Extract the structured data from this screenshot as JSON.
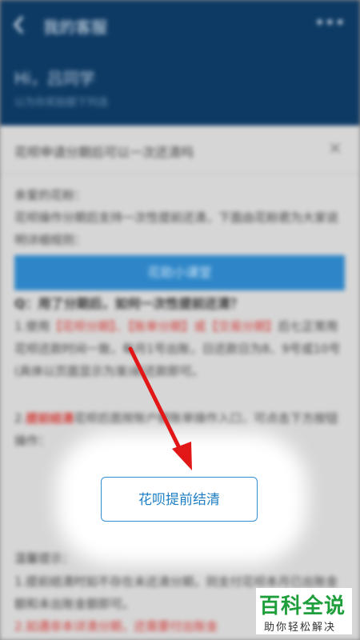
{
  "nav": {
    "back_icon": "chevron-left-icon",
    "title": "我的客服",
    "more_icon": "more-dots-icon",
    "more_glyph": "•••"
  },
  "header": {
    "greeting": "Hi，吕同学",
    "subtitle": "以为你奖励额下列选"
  },
  "sheet": {
    "title": "花呗申请分期后可以一次还清吗",
    "close_glyph": "×",
    "intro": "亲爱的花粉：\n花呗操作分期后支持一次性提前还清，下面由花粉君为大家说明详细规则：",
    "banner": "花助小课堂",
    "question": "Q：用了分期后，如何一次性提前还清？",
    "p2_prefix": "1.使用",
    "p2_red": "【花呗分期】、【账单分期】或【交易分期】",
    "p2_suffix": "后七正常用花呗还款时间一致，每月1号出账，日还款日为8、9号或10号(具体以页面显示为准)前还款即可。",
    "p3_prefix": "2.",
    "p3_red": "提前结清",
    "p3_suffix": "花呗后面按账户额账单操作入口，可点击下方按钮操作：",
    "button": "花呗提前结清",
    "bottom_title": "温馨提示：",
    "p4_a": "1.提前结清时如不存在未还清分期，则支付花呗本月已出账金额和未出账金额即可。",
    "p4_b": "2.如遇非本详清分期，还需要付出账金"
  },
  "watermark": {
    "main": "百科全说",
    "sub": "助你轻松解决"
  },
  "colors": {
    "header_bg": "#0d3a64",
    "banner_bg": "#2e86c8",
    "accent_red": "#d23a36",
    "button_blue": "#1f7fc6",
    "watermark_green": "#1f9f3c"
  }
}
